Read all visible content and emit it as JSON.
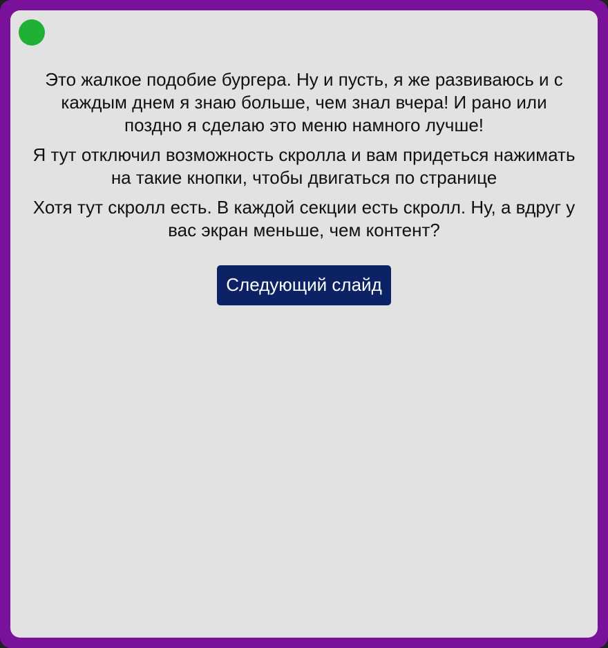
{
  "menu": {
    "icon": "green-circle-icon",
    "color": "#21b036"
  },
  "content": {
    "paragraphs": [
      "Это жалкое подобие бургера. Ну и пусть, я же развиваюсь и с каждым днем я знаю больше, чем знал вчера! И рано или поздно я сделаю это меню намного лучше!",
      "Я тут отключил возможность скролла и вам придеться нажимать на такие кнопки, чтобы двигаться по странице",
      "Хотя тут скролл есть. В каждой секции есть скролл. Ну, а вдруг у вас экран меньше, чем контент?"
    ],
    "next_button_label": "Следующий слайд"
  },
  "colors": {
    "frame": "#7a119a",
    "panel": "#e2e2e3",
    "button": "#0d2165",
    "button_text": "#ffffff"
  }
}
